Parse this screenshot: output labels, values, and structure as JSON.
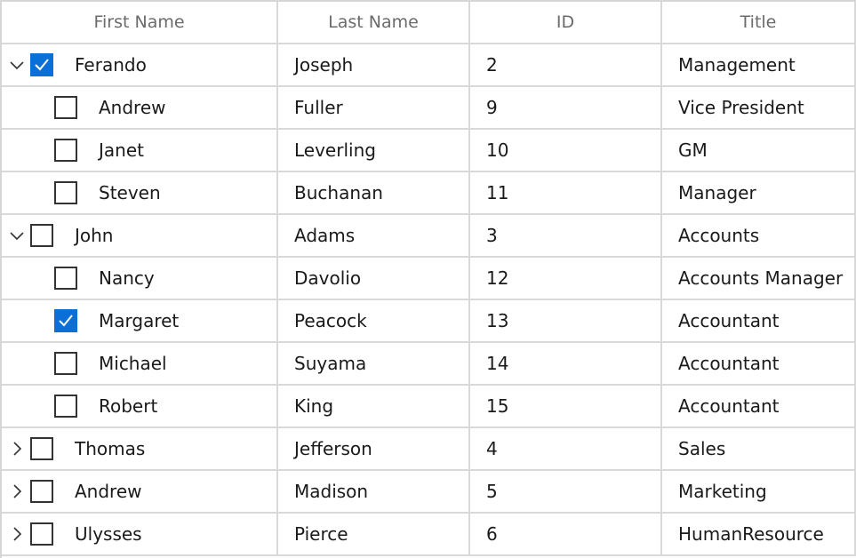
{
  "columns": [
    "First Name",
    "Last Name",
    "ID",
    "Title"
  ],
  "rows": [
    {
      "level": 0,
      "expander": "chevron-down-icon",
      "checked": true,
      "first": "Ferando",
      "last": "Joseph",
      "id": "2",
      "title": "Management"
    },
    {
      "level": 1,
      "expander": "",
      "checked": false,
      "first": "Andrew",
      "last": "Fuller",
      "id": "9",
      "title": "Vice President"
    },
    {
      "level": 1,
      "expander": "",
      "checked": false,
      "first": "Janet",
      "last": "Leverling",
      "id": "10",
      "title": "GM"
    },
    {
      "level": 1,
      "expander": "",
      "checked": false,
      "first": "Steven",
      "last": "Buchanan",
      "id": "11",
      "title": "Manager"
    },
    {
      "level": 0,
      "expander": "chevron-down-icon",
      "checked": false,
      "first": "John",
      "last": "Adams",
      "id": "3",
      "title": "Accounts"
    },
    {
      "level": 1,
      "expander": "",
      "checked": false,
      "first": "Nancy",
      "last": "Davolio",
      "id": "12",
      "title": "Accounts Manager"
    },
    {
      "level": 1,
      "expander": "",
      "checked": true,
      "first": "Margaret",
      "last": "Peacock",
      "id": "13",
      "title": "Accountant"
    },
    {
      "level": 1,
      "expander": "",
      "checked": false,
      "first": "Michael",
      "last": "Suyama",
      "id": "14",
      "title": "Accountant"
    },
    {
      "level": 1,
      "expander": "",
      "checked": false,
      "first": "Robert",
      "last": "King",
      "id": "15",
      "title": "Accountant"
    },
    {
      "level": 0,
      "expander": "chevron-right-icon",
      "checked": false,
      "first": "Thomas",
      "last": "Jefferson",
      "id": "4",
      "title": "Sales"
    },
    {
      "level": 0,
      "expander": "chevron-right-icon",
      "checked": false,
      "first": "Andrew",
      "last": "Madison",
      "id": "5",
      "title": "Marketing"
    },
    {
      "level": 0,
      "expander": "chevron-right-icon",
      "checked": false,
      "first": "Ulysses",
      "last": "Pierce",
      "id": "6",
      "title": "HumanResource"
    }
  ],
  "colors": {
    "accent": "#0b6fd8",
    "gridline": "#d9d9d9",
    "header_text": "#6b6b6b"
  }
}
